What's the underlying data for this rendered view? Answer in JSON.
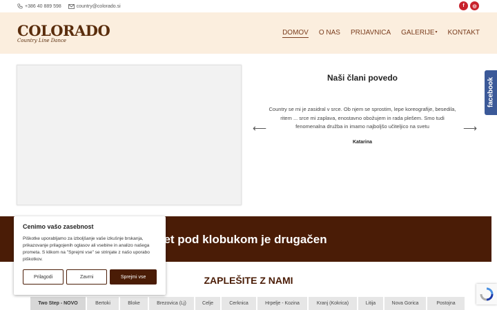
{
  "topbar": {
    "phone": "+386 40 889 598",
    "email": "country@colorado.si",
    "social": [
      {
        "icon": "facebook-icon",
        "glyph": "f"
      },
      {
        "icon": "instagram-icon",
        "glyph": "◎"
      }
    ]
  },
  "logo": {
    "title": "COLORADO",
    "subtitle": "Country Line Dance"
  },
  "nav": {
    "items": [
      "DOMOV",
      "O NAS",
      "PRIJAVNICA",
      "GALERIJE",
      "KONTAKT"
    ],
    "active": "DOMOV"
  },
  "testimonial": {
    "title": "Naši člani povedo",
    "quote": "Country se mi je zasidral v srce. Ob njem se sprostim, lepe koreografije, besedila, ritem ... srce mi zaplava, enostavno obožujem in rada plešem. Smo tudi fenomenalna družba in imamo najboljšo učiteljico na svetu",
    "author": "Katarina",
    "prev_icon": "arrow-left-icon",
    "next_icon": "arrow-right-icon"
  },
  "facebook_tab": "facebook",
  "band": {
    "text": "vet pod klobukom je drugačen"
  },
  "section": {
    "title": "ZAPLEŠITE Z NAMI"
  },
  "locations": [
    "Two Step - NOVO",
    "Bertoki",
    "Bloke",
    "Brezovica (Lj)",
    "Celje",
    "Cerknica",
    "Hrpelje - Kozina",
    "Kranj (Kokrica)",
    "Litija",
    "Nova Gorica",
    "Postojna"
  ],
  "cookie": {
    "title": "Cenimo vašo zasebnost",
    "body": "Piškotke uporabljamo za izboljšanje vaše izkušnje brskanja, prikazovanje prilagojenih oglasov ali vsebine in analizo našega prometa. S klikom na \"Sprejmi vse\" se strinjate z našo uporabo piškotkov.",
    "customize": "Prilagodi",
    "reject": "Zavrni",
    "accept": "Sprejmi vse"
  },
  "colors": {
    "brand": "#4a1c06",
    "header_bg": "#fbeede",
    "social": "#c8222c",
    "facebook": "#3b5998"
  }
}
